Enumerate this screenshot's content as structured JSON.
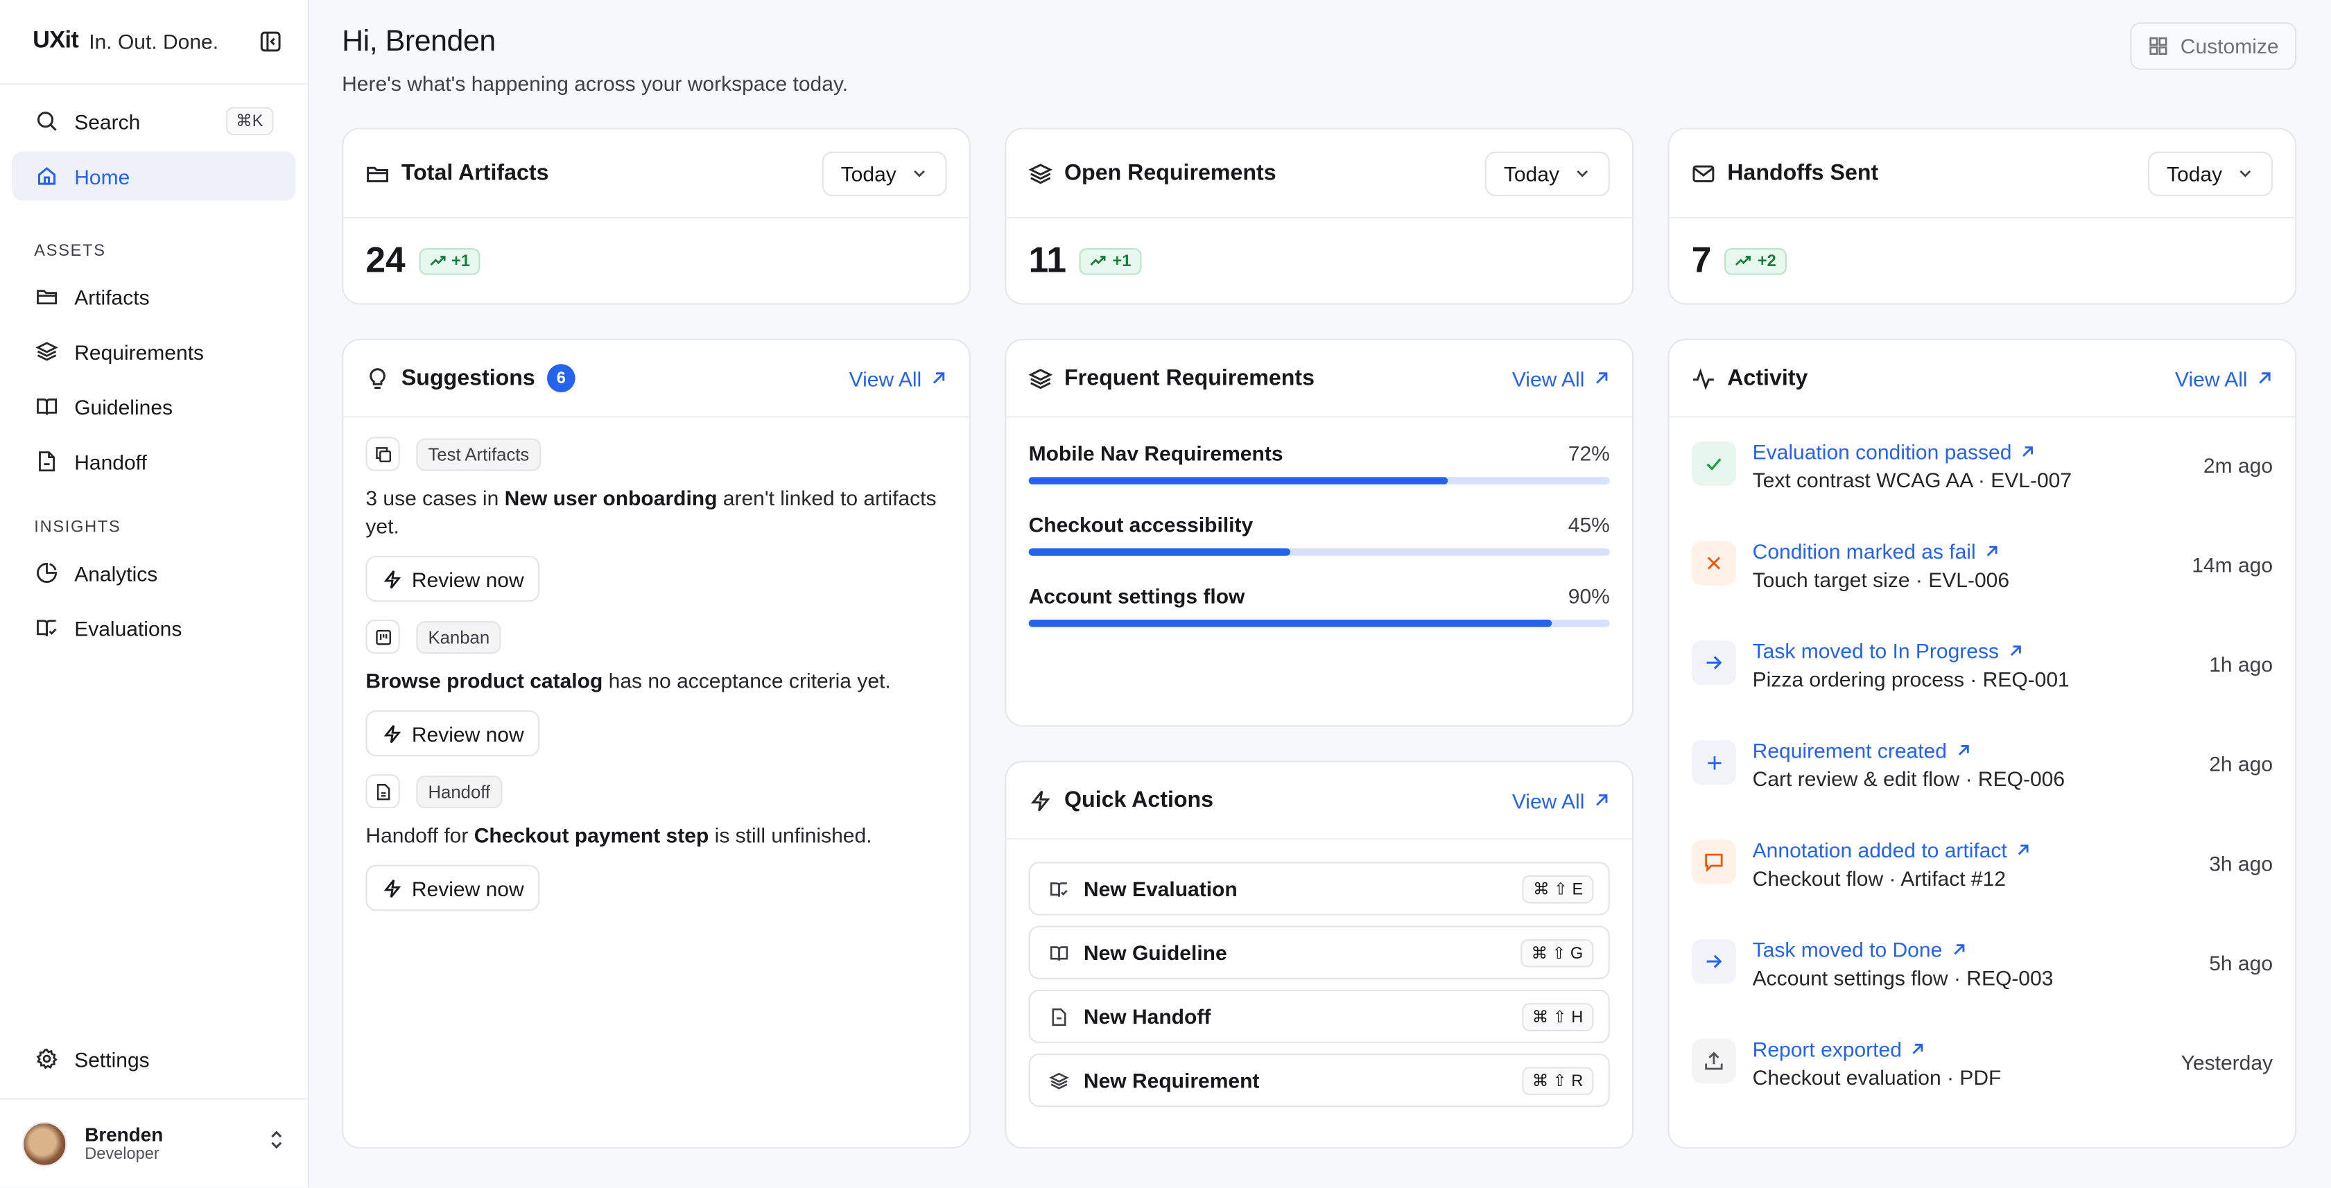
{
  "brand": {
    "logo": "UXit",
    "tagline": "In. Out. Done."
  },
  "sidebar": {
    "search": {
      "label": "Search",
      "shortcut": "⌘K"
    },
    "home": "Home",
    "sections": [
      {
        "label": "ASSETS",
        "items": [
          "Artifacts",
          "Requirements",
          "Guidelines",
          "Handoff"
        ]
      },
      {
        "label": "INSIGHTS",
        "items": [
          "Analytics",
          "Evaluations"
        ]
      }
    ],
    "settings": "Settings",
    "user": {
      "name": "Brenden",
      "role": "Developer"
    }
  },
  "header": {
    "greeting": "Hi, Brenden",
    "subtitle": "Here's what's happening across your workspace today.",
    "customize": "Customize"
  },
  "stats": [
    {
      "title": "Total Artifacts",
      "range": "Today",
      "value": "24",
      "delta": "+1",
      "icon": "folder-icon"
    },
    {
      "title": "Open Requirements",
      "range": "Today",
      "value": "11",
      "delta": "+1",
      "icon": "layers-icon"
    },
    {
      "title": "Handoffs Sent",
      "range": "Today",
      "value": "7",
      "delta": "+2",
      "icon": "mail-icon"
    }
  ],
  "suggestions": {
    "title": "Suggestions",
    "count": "6",
    "view_all": "View All",
    "items": [
      {
        "tag": "Test Artifacts",
        "pre": "3 use cases in ",
        "bold": "New user onboarding",
        "post": " aren't linked to artifacts yet.",
        "action": "Review now"
      },
      {
        "tag": "Kanban",
        "pre": "",
        "bold": "Browse product catalog",
        "post": " has no acceptance criteria yet.",
        "action": "Review now"
      },
      {
        "tag": "Handoff",
        "pre": "Handoff for ",
        "bold": "Checkout payment step",
        "post": " is still unfinished.",
        "action": "Review now"
      }
    ]
  },
  "frequent": {
    "title": "Frequent Requirements",
    "view_all": "View All",
    "items": [
      {
        "label": "Mobile Nav Requirements",
        "pct_label": "72%",
        "value": 0.72
      },
      {
        "label": "Checkout accessibility",
        "pct_label": "45%",
        "value": 0.45
      },
      {
        "label": "Account settings flow",
        "pct_label": "90%",
        "value": 0.9
      }
    ]
  },
  "quick_actions": {
    "title": "Quick Actions",
    "view_all": "View All",
    "items": [
      {
        "label": "New Evaluation",
        "shortcut": "⌘ ⇧ E"
      },
      {
        "label": "New Guideline",
        "shortcut": "⌘ ⇧ G"
      },
      {
        "label": "New Handoff",
        "shortcut": "⌘ ⇧ H"
      },
      {
        "label": "New Requirement",
        "shortcut": "⌘ ⇧ R"
      }
    ]
  },
  "activity": {
    "title": "Activity",
    "view_all": "View All",
    "items": [
      {
        "title": "Evaluation condition passed",
        "sub": "Text contrast WCAG AA · EVL-007",
        "time": "2m ago",
        "icon": "check-icon"
      },
      {
        "title": "Condition marked as fail",
        "sub": "Touch target size · EVL-006",
        "time": "14m ago",
        "icon": "x-icon"
      },
      {
        "title": "Task moved to In Progress",
        "sub": "Pizza ordering process · REQ-001",
        "time": "1h ago",
        "icon": "arrow-right-icon"
      },
      {
        "title": "Requirement created",
        "sub": "Cart review & edit flow · REQ-006",
        "time": "2h ago",
        "icon": "plus-icon"
      },
      {
        "title": "Annotation added to artifact",
        "sub": "Checkout flow · Artifact #12",
        "time": "3h ago",
        "icon": "comment-icon"
      },
      {
        "title": "Task moved to Done",
        "sub": "Account settings flow · REQ-003",
        "time": "5h ago",
        "icon": "arrow-right-icon"
      },
      {
        "title": "Report exported",
        "sub": "Checkout evaluation · PDF",
        "time": "Yesterday",
        "icon": "upload-icon"
      }
    ]
  },
  "colors": {
    "accent": "#2563eb",
    "success": "#16a34a",
    "warning": "#ea580c",
    "background": "#f7f8fa"
  }
}
